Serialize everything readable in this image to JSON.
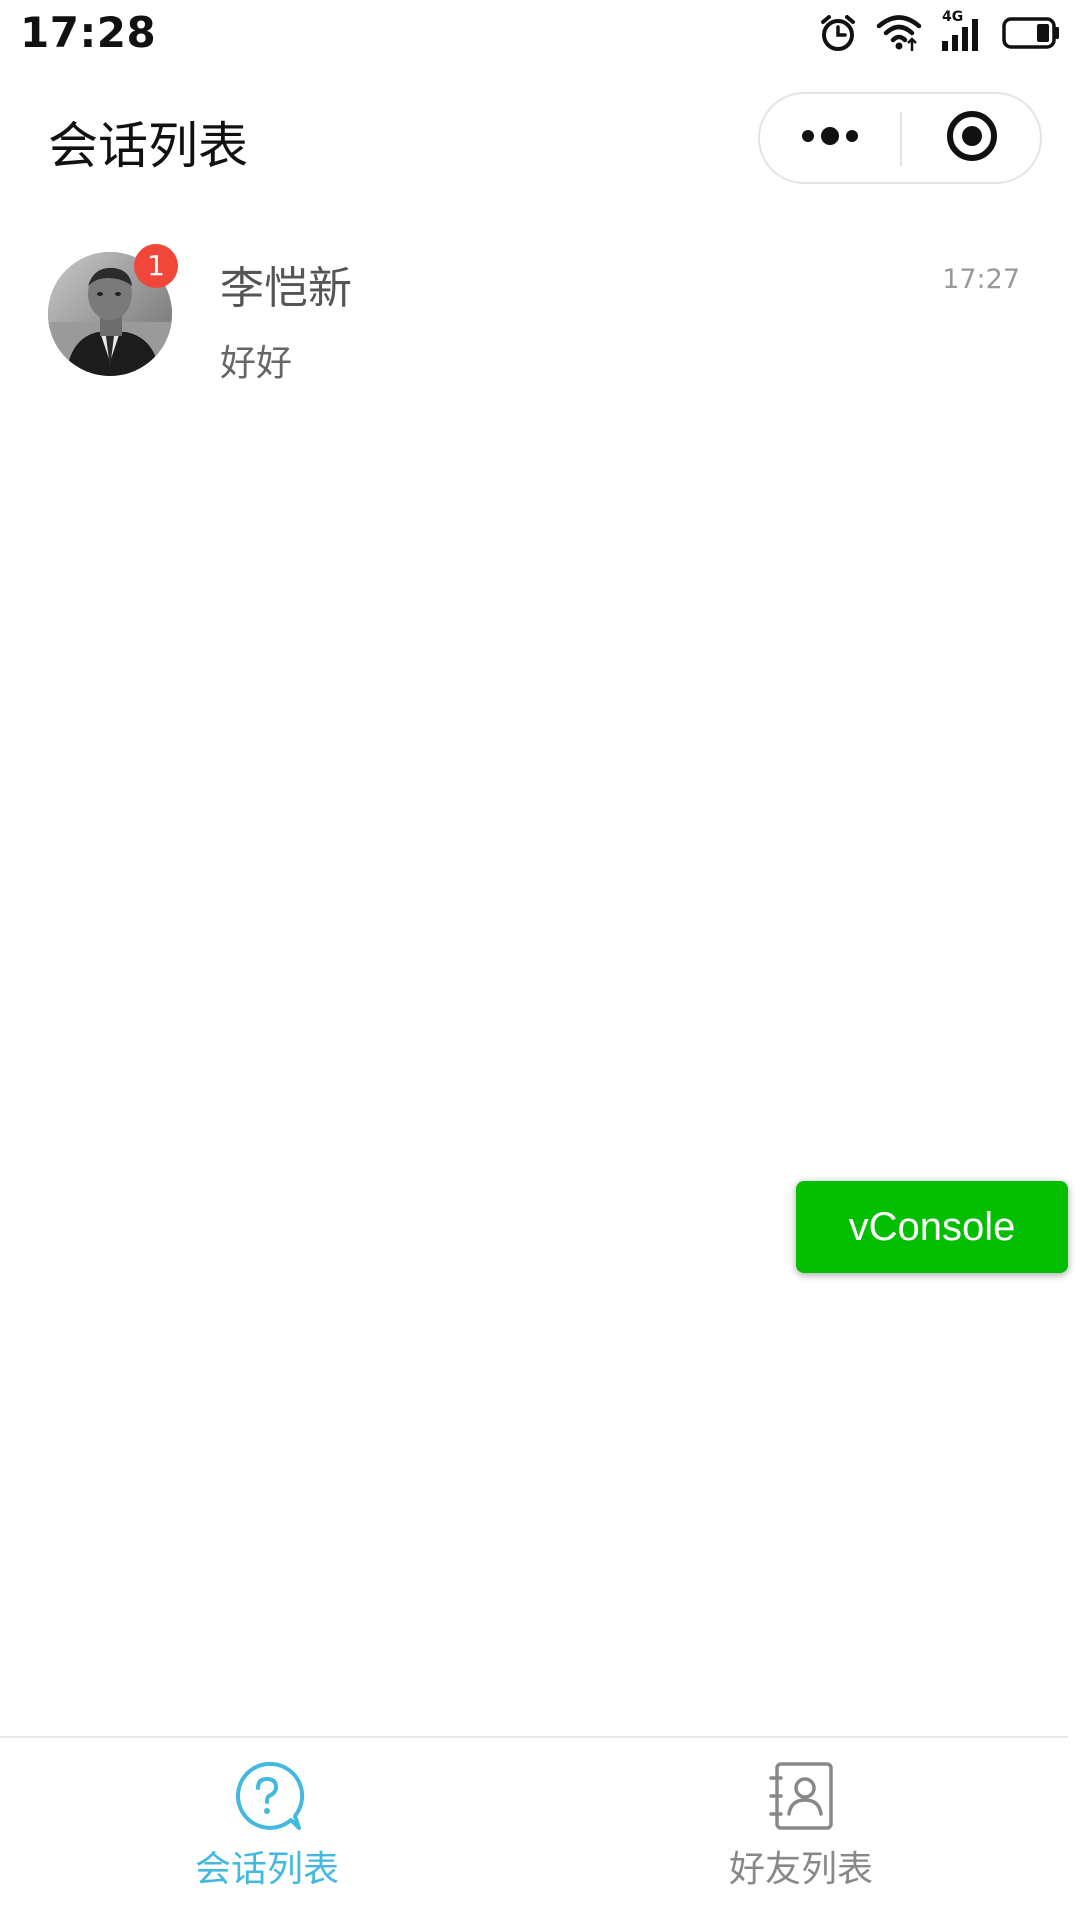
{
  "status_bar": {
    "time": "17:28",
    "network_label": "4G",
    "icons": [
      "alarm-icon",
      "wifi-icon",
      "cellular-signal-icon",
      "battery-icon"
    ]
  },
  "header": {
    "title": "会话列表",
    "capsule_icons": [
      "more-dots-icon",
      "close-target-icon"
    ]
  },
  "conversations": [
    {
      "name": "李恺新",
      "last_message": "好好",
      "time": "17:27",
      "unread": "1",
      "avatar": "avatar-photo"
    }
  ],
  "vconsole": {
    "label": "vConsole",
    "color": "#04be02"
  },
  "tab_bar": {
    "tabs": [
      {
        "label": "会话列表",
        "icon": "chat-question-icon",
        "active": true
      },
      {
        "label": "好友列表",
        "icon": "contacts-book-icon",
        "active": false
      }
    ],
    "active_color": "#44b9df",
    "inactive_color": "#888888"
  },
  "colors": {
    "badge": "#f0473a",
    "border": "#e4e4e4"
  }
}
